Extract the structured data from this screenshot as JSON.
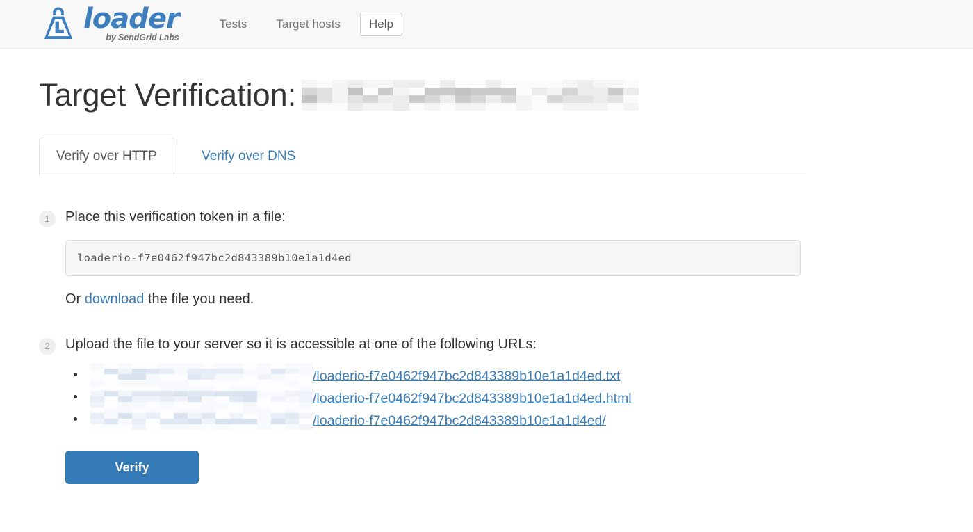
{
  "header": {
    "brand": {
      "word": "loader",
      "sub": "by SendGrid Labs",
      "logo_color": "#3d7ebf"
    },
    "nav": [
      {
        "label": "Tests"
      },
      {
        "label": "Target hosts"
      }
    ],
    "help_label": "Help"
  },
  "page": {
    "title_prefix": "Target Verification:",
    "title_target_redacted": true
  },
  "tabs": [
    {
      "label": "Verify over HTTP",
      "active": true
    },
    {
      "label": "Verify over DNS",
      "active": false
    }
  ],
  "steps": [
    {
      "number": "1",
      "text": "Place this verification token in a file:",
      "token": "loaderio-f7e0462f947bc2d843389b10e1a1d4ed",
      "download_prefix": "Or ",
      "download_link": "download",
      "download_suffix": " the file you need."
    },
    {
      "number": "2",
      "text": "Upload the file to your server so it is accessible at one of the following URLs:",
      "urls": [
        {
          "host_redacted": true,
          "path": "/loaderio-f7e0462f947bc2d843389b10e1a1d4ed.txt"
        },
        {
          "host_redacted": true,
          "path": "/loaderio-f7e0462f947bc2d843389b10e1a1d4ed.html"
        },
        {
          "host_redacted": true,
          "path": "/loaderio-f7e0462f947bc2d843389b10e1a1d4ed/"
        }
      ]
    }
  ],
  "actions": {
    "verify_label": "Verify",
    "verify_color": "#337ab7"
  }
}
